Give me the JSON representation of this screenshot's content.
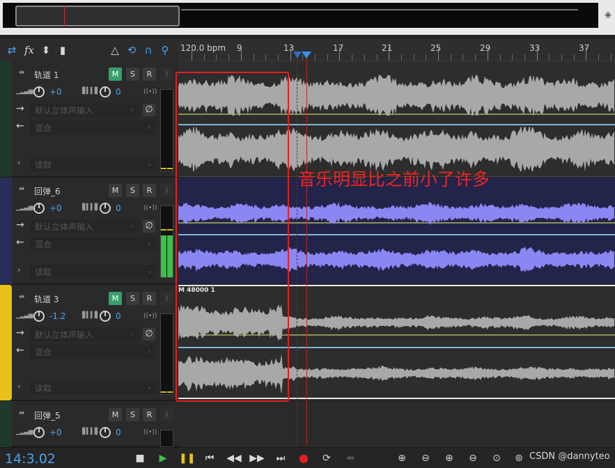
{
  "toolbar": {
    "icons": [
      "arrows-swap-icon",
      "fx-icon",
      "sends-icon",
      "eq-bars-icon",
      "metronome-icon",
      "loop-record-icon",
      "headphones-icon",
      "marker-pin-icon"
    ],
    "fx_label": "fx"
  },
  "ruler": {
    "bpm_label": "120.0 bpm",
    "labels": [
      "9",
      "13",
      "17",
      "21",
      "25",
      "29",
      "33",
      "37"
    ]
  },
  "tracks": [
    {
      "name": "轨道 1",
      "mute": "M",
      "solo": "S",
      "record": "R",
      "input_monitor": "I",
      "volume": "+0",
      "pan": "0",
      "input": "默认立体声输入",
      "output": "混合",
      "automation": "读取",
      "color": "#1e3a2a",
      "mute_on": true
    },
    {
      "name": "回弹_6",
      "mute": "M",
      "solo": "S",
      "record": "R",
      "input_monitor": "I",
      "volume": "+0",
      "pan": "0",
      "input": "默认立体声输入",
      "output": "混合",
      "automation": "读取",
      "color": "#2a2d5a",
      "mute_on": false
    },
    {
      "name": "轨道 3",
      "mute": "M",
      "solo": "S",
      "record": "R",
      "input_monitor": "I",
      "volume": "-1.2",
      "pan": "0",
      "input": "默认立体声输入",
      "output": "混合",
      "automation": "读取",
      "color": "#e8c21a",
      "mute_on": true,
      "clip_label": "M 48000 1"
    },
    {
      "name": "回弹_5",
      "mute": "M",
      "solo": "S",
      "record": "R",
      "input_monitor": "I",
      "volume": "+0",
      "pan": "0",
      "color": "#1e3a2a",
      "mute_on": false
    }
  ],
  "annotation": {
    "text": "音乐明显比之前小了许多",
    "color": "#ee2525"
  },
  "transport": {
    "timecode": "14:3.02",
    "buttons": [
      "stop-icon",
      "play-icon",
      "pause-icon",
      "go-to-start-icon",
      "rewind-icon",
      "fast-forward-icon",
      "go-to-end-icon",
      "record-icon",
      "loop-icon",
      "skip-selection-icon"
    ],
    "zoom_buttons": [
      "zoom-in-amplitude-icon",
      "zoom-out-amplitude-icon",
      "zoom-in-time-icon",
      "zoom-out-time-icon",
      "zoom-selection-icon"
    ]
  },
  "watermark": "CSDN @dannyteo",
  "colors": {
    "accent_blue": "#4aa3f0",
    "mute_green": "#3aa06a",
    "waveform_gray": "#a8a8a8",
    "waveform_purple": "#8a86f2",
    "playhead_red": "#c42222"
  }
}
